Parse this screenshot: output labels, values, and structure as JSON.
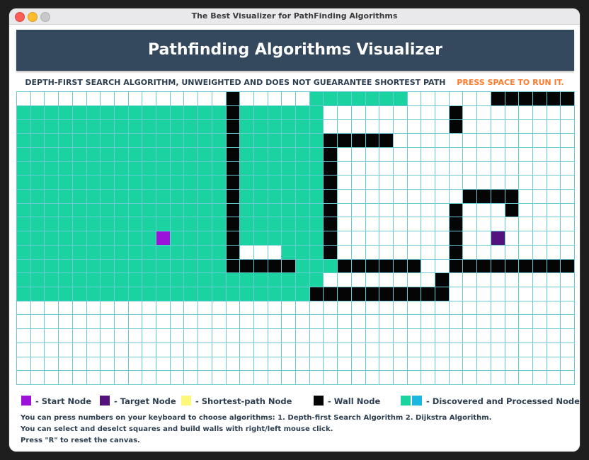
{
  "window": {
    "title": "The Best Visualizer for PathFinding Algorithms"
  },
  "header": {
    "title": "Pathfinding Algorithms Visualizer"
  },
  "subtitle": {
    "algorithm": "DEPTH-FIRST SEARCH ALGORITHM, UNWEIGHTED AND DOES NOT GUEARANTEE SHORTEST PATH",
    "run_hint": "PRESS SPACE TO RUN IT."
  },
  "grid": {
    "columns": 40,
    "rows": 21,
    "cells": [
      "...............w.....ddddddd......wwwwwwwwwwwwwwww",
      "dddddddddddddddwdddddd.........w..................",
      "dddddddddddddddwdddddd.........w..................",
      "dddddddddddddddwddddddwwwww.......................",
      "dddddddddddddddwddddddw...........................",
      "dddddddddddddddwddddddw...........................",
      "dddddddddddddddwddddddw...........................",
      "dddddddddddddddwddddddw.........wwww..............",
      "dddddddddddddddwddddddw........w...w..............",
      "dddddddddddddddwddddddw........w..................",
      "ddddddddddsddddwddddddw........w..t...............",
      "dddddddddddddddw...dddw........w..................",
      "dddddddddddddddwwwwwdddwwwwww..wwwwwwwwwwwww......",
      "dddddddddddddddddddddd........w...................",
      "dddddddddddddddddddddwwwwwwwwww...................",
      "........................................",
      "........................................",
      "........................................",
      "........................................",
      "........................................",
      "........................................"
    ]
  },
  "legend": [
    {
      "label": "- Start Node",
      "colors": [
        "#9b13d8"
      ]
    },
    {
      "label": "- Target Node",
      "colors": [
        "#54127d"
      ]
    },
    {
      "label": "- Shortest-path Node",
      "colors": [
        "#fdf87c"
      ]
    },
    {
      "label": "- Wall Node",
      "colors": [
        "#050505"
      ]
    },
    {
      "label": "- Discovered and Processed Nodes",
      "colors": [
        "#1ad3a1",
        "#1ab8e0"
      ]
    }
  ],
  "instructions": [
    "You can press numbers on your keyboard to choose algorithms: 1. Depth-first Search Algorithm 2. Dijkstra Algorithm.",
    "You can select and deselct squares and build walls with right/left mouse click.",
    "Press \"R\" to reset the canvas."
  ],
  "colors": {
    "header_bg": "#34495e",
    "run_hint": "#ff7b2e",
    "grid_line": "#67cbd6",
    "discovered": "#1ad3a1",
    "wall": "#050505",
    "start": "#9b13d8",
    "target": "#54127d"
  }
}
